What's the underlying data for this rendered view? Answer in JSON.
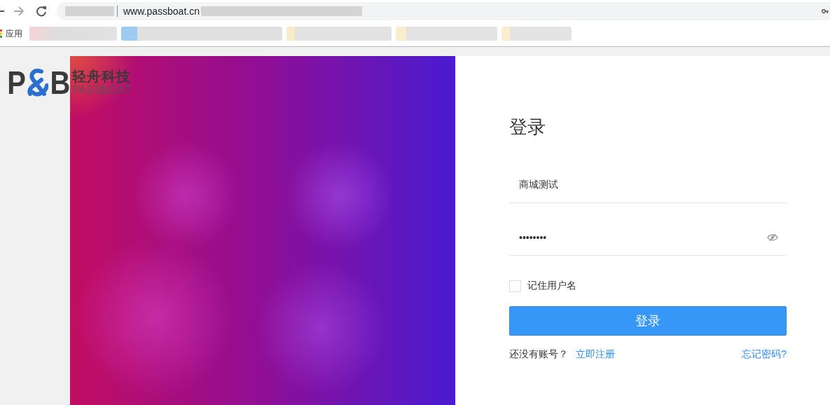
{
  "browser": {
    "url": "www.passboat.cn",
    "bookmarks_label": "应用"
  },
  "logo": {
    "letter_left": "P",
    "letter_right": "B",
    "name": "轻舟科技",
    "name_en": "PASSBOAT"
  },
  "login": {
    "title": "登录",
    "username": {
      "value": "商城测试"
    },
    "password": {
      "value": "••••••••"
    },
    "remember": {
      "label": "记住用户名",
      "checked": false
    },
    "submit": "登录",
    "signup_prompt": "还没有账号？",
    "signup_link": "立即注册",
    "forgot_link": "忘记密码?"
  }
}
